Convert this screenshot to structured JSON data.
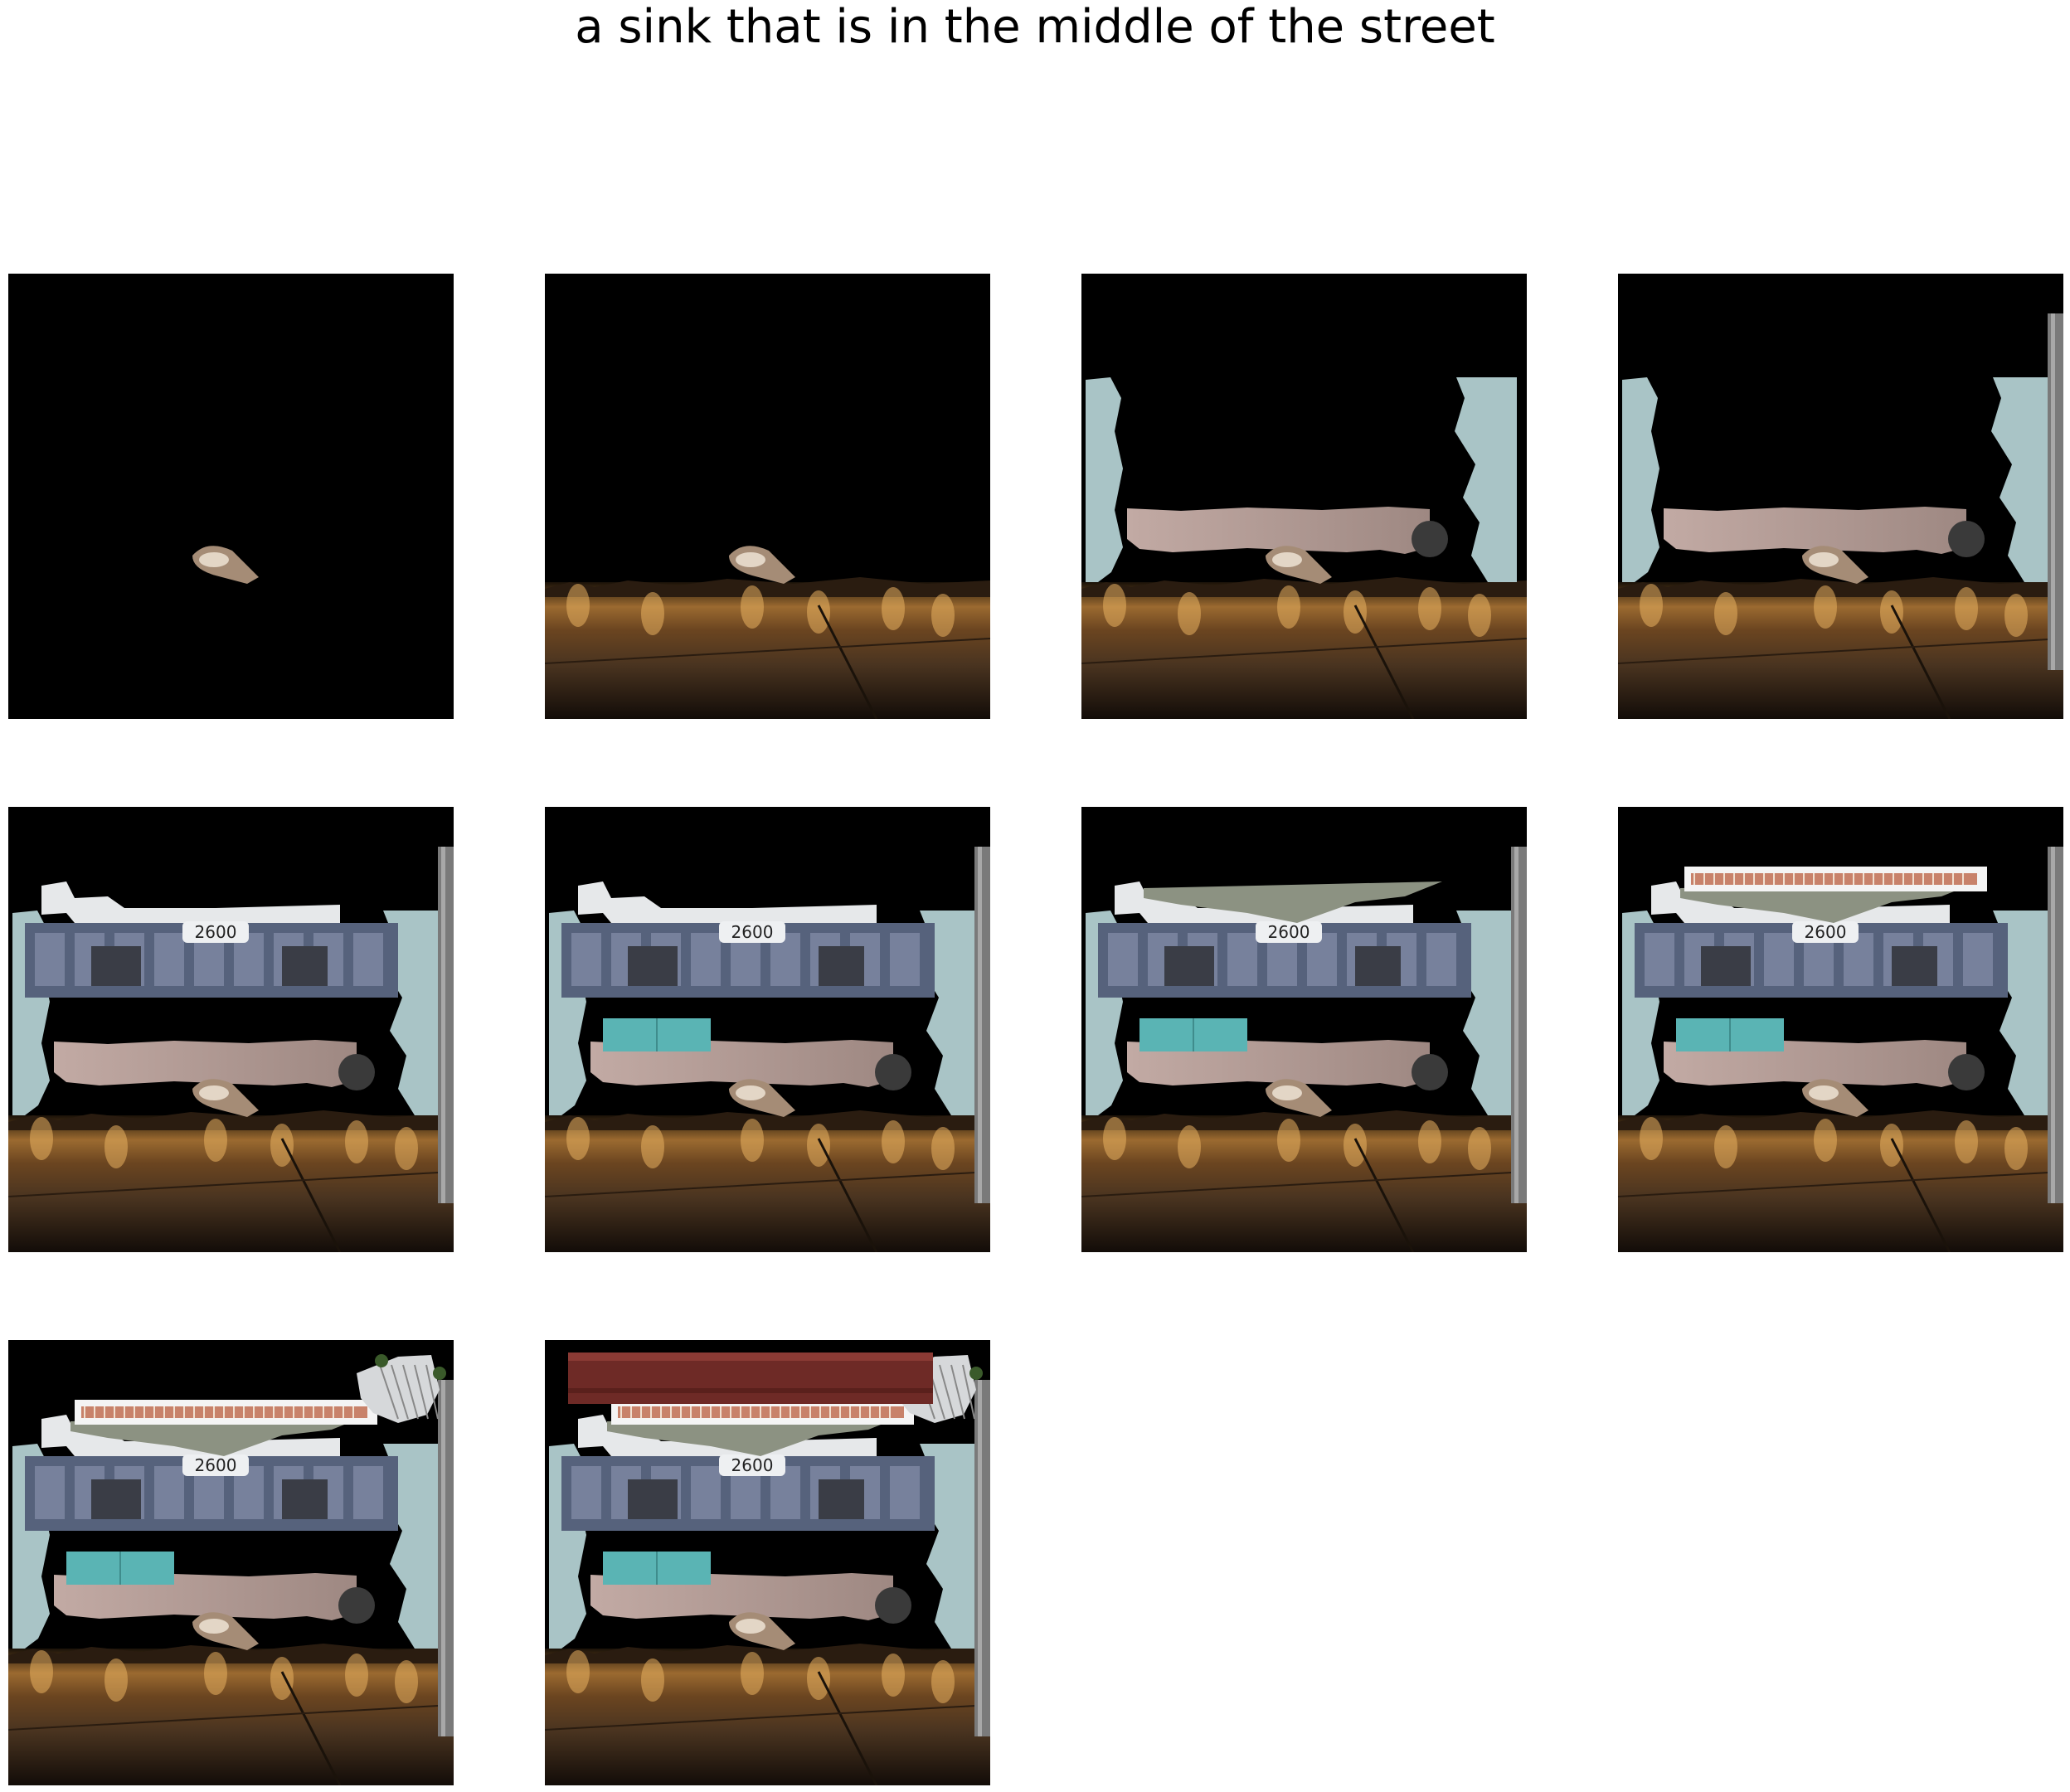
{
  "figure": {
    "title": "a sink that is in the middle of the street"
  },
  "panels": [
    {
      "step": 1,
      "layers": [
        "sink"
      ]
    },
    {
      "step": 2,
      "layers": [
        "sink",
        "street"
      ]
    },
    {
      "step": 3,
      "layers": [
        "sink",
        "street",
        "wall"
      ]
    },
    {
      "step": 4,
      "layers": [
        "sink",
        "street",
        "wall",
        "pole"
      ]
    },
    {
      "step": 5,
      "layers": [
        "sink",
        "street",
        "wall",
        "pole",
        "building"
      ]
    },
    {
      "step": 6,
      "layers": [
        "sink",
        "street",
        "wall",
        "pole",
        "building",
        "blocks"
      ]
    },
    {
      "step": 7,
      "layers": [
        "sink",
        "street",
        "wall",
        "pole",
        "building",
        "blocks",
        "canopy"
      ]
    },
    {
      "step": 8,
      "layers": [
        "sink",
        "street",
        "wall",
        "pole",
        "building",
        "blocks",
        "canopy",
        "sign"
      ]
    },
    {
      "step": 9,
      "layers": [
        "sink",
        "street",
        "wall",
        "pole",
        "building",
        "blocks",
        "canopy",
        "sign",
        "tree"
      ]
    },
    {
      "step": 10,
      "layers": [
        "sink",
        "street",
        "wall",
        "pole",
        "building",
        "blocks",
        "canopy",
        "sign",
        "tree",
        "roof"
      ]
    }
  ],
  "building_sign_text": "2600",
  "colors": {
    "background": "#000000",
    "sink": "#a58c76",
    "street": "#4a3420",
    "wall": "#b29a96",
    "side_wall": "#a9c4c6",
    "building": "#56627c",
    "blocks": "#5ab4b4",
    "canopy": "#8c9282",
    "sign": "#c8826a",
    "roof": "#6e2a26"
  }
}
